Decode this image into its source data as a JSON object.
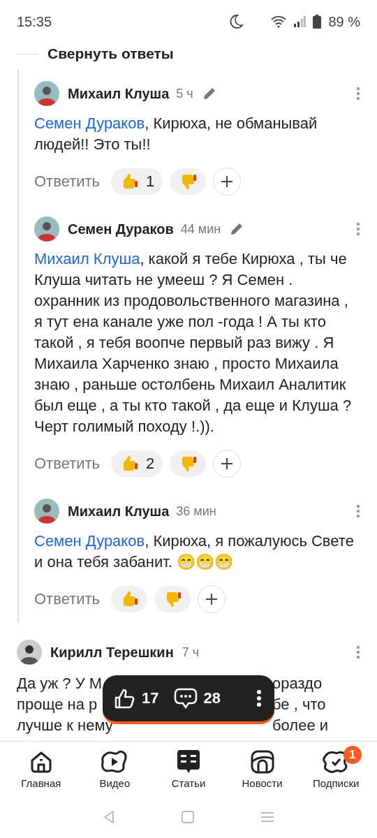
{
  "status_bar": {
    "time": "15:35",
    "battery": "89 %"
  },
  "collapse_replies": "Свернуть ответы",
  "replies": [
    {
      "author": "Михаил Клуша",
      "time": "5 ч",
      "edited": true,
      "mention": "Семен Дураков",
      "text": ", Кирюха, не обманывай людей!! Это ты!!",
      "reply": "Ответить",
      "likes": "1"
    },
    {
      "author": "Семен Дураков",
      "time": "44 мин",
      "edited": true,
      "mention": "Михаил Клуша",
      "text": ", какой я тебе Кирюха , ты че Клуша читать не умееш ? Я Семен . охранник из продовольственного магазина , я тут ена канале уже пол -года ! А ты кто такой , я тебя воопче первый раз вижу . Я Михаила Харченко знаю , просто Михаила знаю , раньше остолбень Михаил Аналитик был еще , а ты кто такой , да еще и Клуша ? Черт голимый походу !.)).",
      "reply": "Ответить",
      "likes": "2"
    },
    {
      "author": "Михаил Клуша",
      "time": "36 мин",
      "edited": false,
      "mention": "Семен Дураков",
      "text": ", Кирюха, я пожалуюсь Свете и она тебя забанит. 😁😁😁",
      "reply": "Ответить"
    }
  ],
  "comment": {
    "author": "Кирилл Терешкин",
    "time": "7 ч",
    "lines": [
      {
        "left": "Да уж ? У М",
        "right": "ораздо"
      },
      {
        "left": "проще на р",
        "right": "бе , что"
      },
      {
        "left": "лучше к нему",
        "right": "более и"
      }
    ]
  },
  "floating_bar": {
    "likes": "17",
    "comments": "28"
  },
  "bottom_nav": [
    {
      "label": "Главная"
    },
    {
      "label": "Видео"
    },
    {
      "label": "Статьи"
    },
    {
      "label": "Новости"
    },
    {
      "label": "Подписки",
      "badge": "1"
    }
  ]
}
